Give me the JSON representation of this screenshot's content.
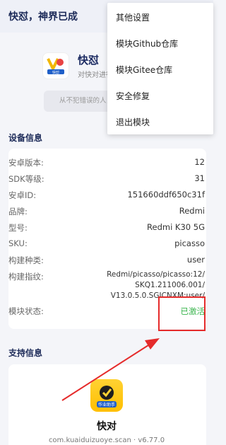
{
  "header": {
    "title": "快怼，神界已成"
  },
  "hero": {
    "app_name": "快怼",
    "logo_text": "快怼",
    "description": "对快对进行",
    "quote": "从不犯错误的人，"
  },
  "menu": {
    "items": [
      "其他设置",
      "模块Github仓库",
      "模块Gitee仓库",
      "安全修复",
      "退出模块"
    ]
  },
  "device_info": {
    "section_title": "设备信息",
    "rows": [
      {
        "key": "安卓版本:",
        "value": "12"
      },
      {
        "key": "SDK等级:",
        "value": "31"
      },
      {
        "key": "安卓ID:",
        "value": "151660ddf650c31f"
      },
      {
        "key": "品牌:",
        "value": "Redmi"
      },
      {
        "key": "型号:",
        "value": "Redmi K30 5G"
      },
      {
        "key": "SKU:",
        "value": "picasso"
      },
      {
        "key": "构建种类:",
        "value": "user"
      }
    ],
    "fingerprint": {
      "key": "构建指纹:",
      "lines": [
        "Redmi/picasso/picasso:12/",
        "SKQ1.211006.001/",
        "V13.0.5.0.SGICNXM:user/"
      ]
    },
    "status": {
      "key": "模块状态:",
      "value": "已激活"
    }
  },
  "support_info": {
    "section_title": "支持信息",
    "icon_text": "作业助手",
    "app_name": "快对",
    "package": "com.kuaiduizuoye.scan · v6.77.0"
  },
  "colors": {
    "status_active": "#36b34a",
    "highlight": "#e52b2b",
    "title": "#1c2a58"
  }
}
